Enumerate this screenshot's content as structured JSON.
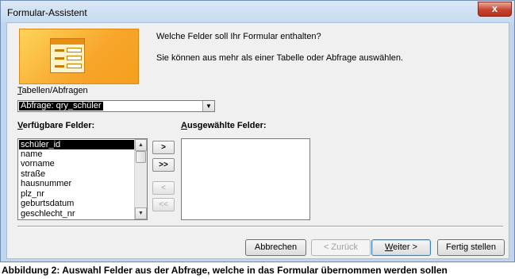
{
  "window": {
    "title": "Formular-Assistent",
    "close_glyph": "x"
  },
  "header": {
    "question": "Welche Felder soll Ihr Formular enthalten?",
    "hint": "Sie können aus mehr als einer Tabelle oder Abfrage auswählen."
  },
  "source": {
    "label_underlined": "T",
    "label_rest": "abellen/Abfragen",
    "selected_value": "Abfrage: qry_schüler"
  },
  "available": {
    "label_underlined": "V",
    "label_rest": "erfügbare Felder:",
    "items": [
      "schüler_id",
      "name",
      "vorname",
      "straße",
      "hausnummer",
      "plz_nr",
      "geburtsdatum",
      "geschlecht_nr"
    ],
    "selected_index": 0
  },
  "selected": {
    "label_underlined": "A",
    "label_rest": "usgewählte Felder:"
  },
  "move_buttons": {
    "add_one": ">",
    "add_all": ">>",
    "remove_one": "<",
    "remove_all": "<<"
  },
  "footer": {
    "cancel": "Abbrechen",
    "back": "< Zurück",
    "next_underlined": "W",
    "next_rest": "eiter >",
    "finish": "Fertig stellen"
  },
  "caption": "Abbildung 2: Auswahl Felder aus der Abfrage, welche in das Formular übernommen werden sollen"
}
